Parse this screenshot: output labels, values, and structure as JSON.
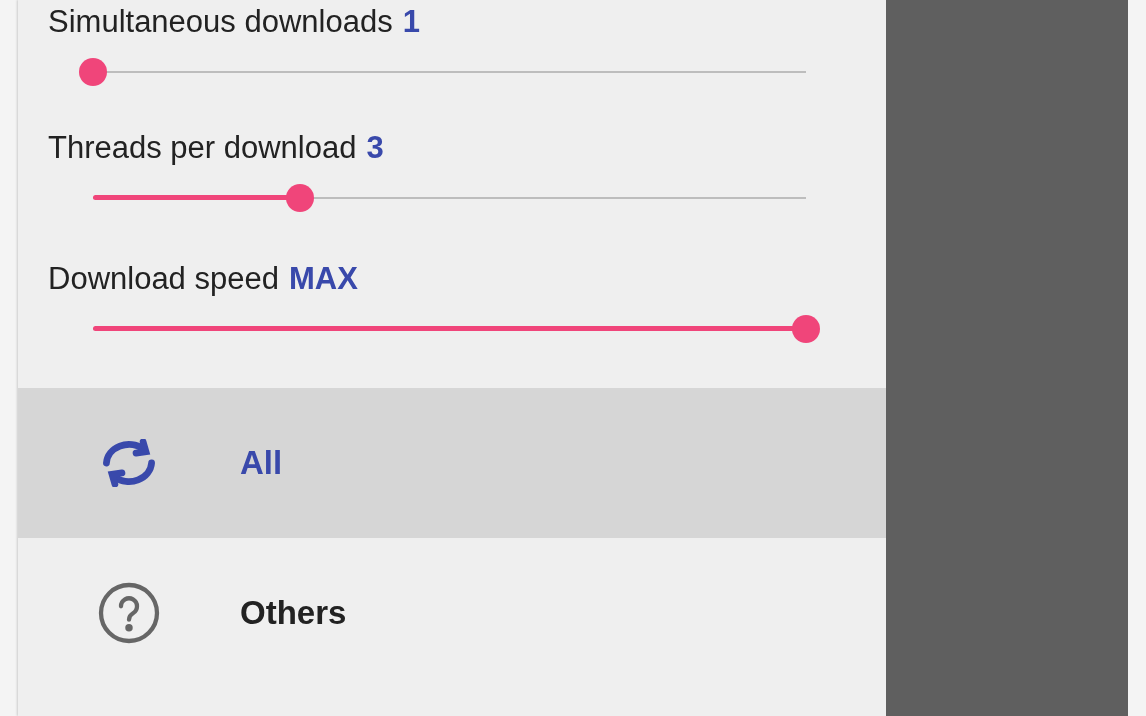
{
  "settings": [
    {
      "label": "Simultaneous downloads",
      "value": "1",
      "level": 0
    },
    {
      "label": "Threads per download",
      "value": "3",
      "level": 0.29
    },
    {
      "label": "Download speed",
      "value": "MAX",
      "level": 1
    }
  ],
  "nav_items": [
    {
      "kind": "sync",
      "label": "All",
      "selected": true
    },
    {
      "kind": "help",
      "label": "Others",
      "selected": false
    }
  ]
}
